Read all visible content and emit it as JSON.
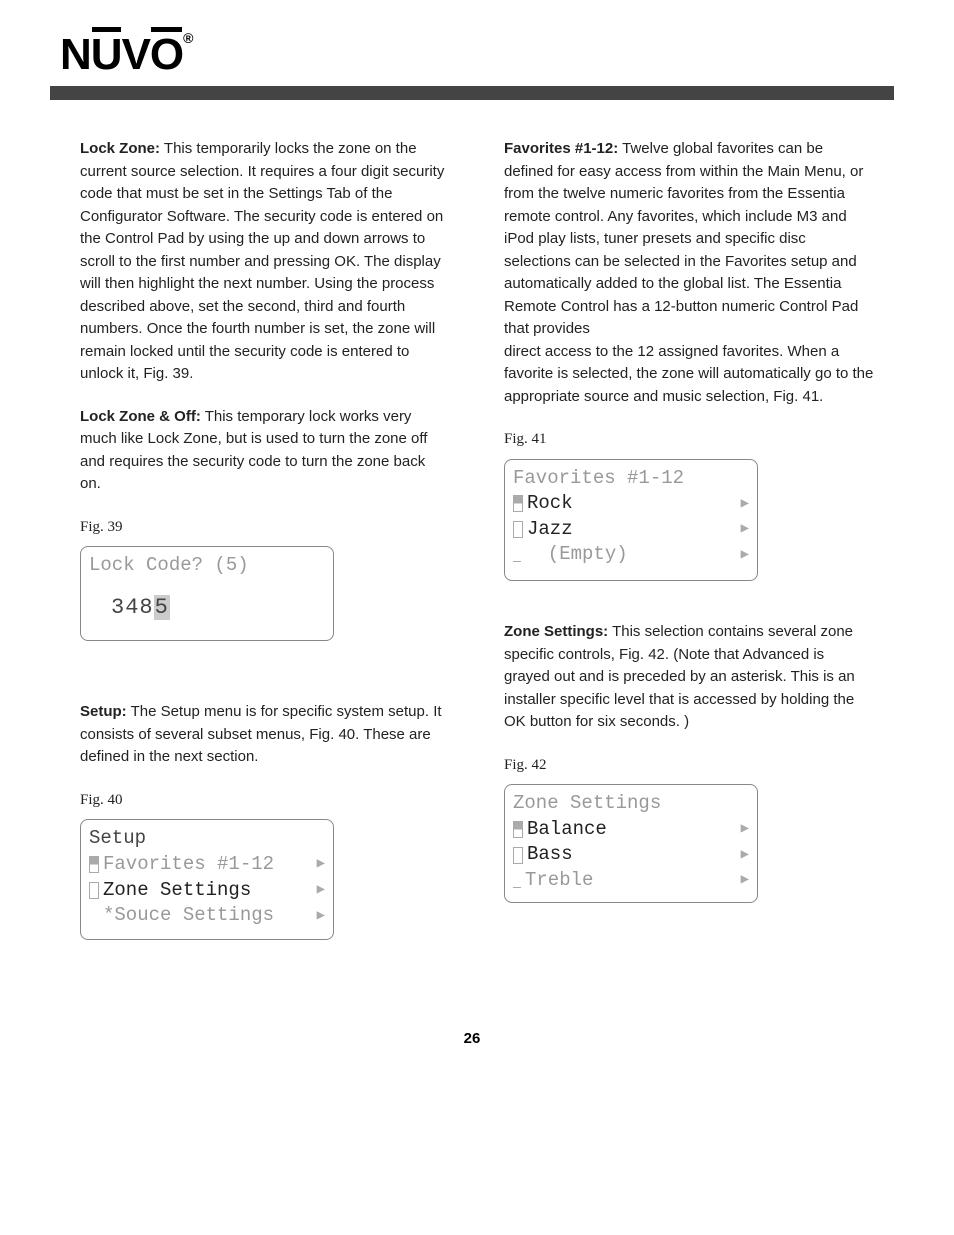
{
  "brand": "NUVO",
  "page_number": "26",
  "left": {
    "p1_lead": "Lock Zone:",
    "p1_body": "  This temporarily locks the zone on the current source selection. It requires a four digit security code that must be set in the Settings Tab of the Configurator Software. The security code is entered on the Control Pad  by using the up and down arrows to scroll to the first number and pressing OK. The display will then highlight the next number. Using the process described above, set the second, third and fourth numbers. Once the fourth number is set, the zone will remain locked until the security code is entered to unlock it, Fig. 39.",
    "p2_lead": "Lock Zone & Off:",
    "p2_body": "  This temporary lock works very much like Lock Zone, but is used to turn the zone off and requires the security code to turn the zone back on.",
    "fig39_cap": "Fig. 39",
    "fig39_title": "Lock Code? (5)",
    "fig39_code_entered": "348",
    "fig39_code_cursor": "5",
    "p3_lead": "Setup:",
    "p3_body": "  The Setup menu is for specific system setup. It consists of several subset menus, Fig. 40. These are defined in the next section.",
    "fig40_cap": "Fig. 40",
    "fig40_title": "Setup",
    "fig40_item1": "Favorites #1-12",
    "fig40_item2": "Zone Settings",
    "fig40_item3": "*Souce Settings"
  },
  "right": {
    "p1_lead": "Favorites #1-12:",
    "p1_body": "  Twelve global favorites can be defined for easy access from within the Main Menu, or from the twelve numeric favorites from the Essentia remote control.  Any favorites, which include M3 and iPod play lists, tuner presets and specific disc selections can be selected in the Favorites setup and automatically added to the global list. The Essentia Remote Control has a 12-button numeric Control Pad that provides",
    "p1_body2": "direct access to the 12 assigned favorites. When a favorite is selected, the zone will automatically go to the appropriate source and music  selection, Fig. 41.",
    "fig41_cap": "Fig. 41",
    "fig41_title": "Favorites #1-12",
    "fig41_item1": "Rock",
    "fig41_item2": "Jazz",
    "fig41_item3": "  (Empty)",
    "p2_lead": "Zone Settings:",
    "p2_body": "  This selection contains several zone specific controls, Fig. 42. (Note that Advanced is grayed out and is preceded by an asterisk. This is an installer specific level that is accessed by holding the OK button for six seconds. )",
    "fig42_cap": "Fig. 42",
    "fig42_title": "Zone Settings",
    "fig42_item1": "Balance",
    "fig42_item2": "Bass",
    "fig42_item3": "Treble"
  }
}
